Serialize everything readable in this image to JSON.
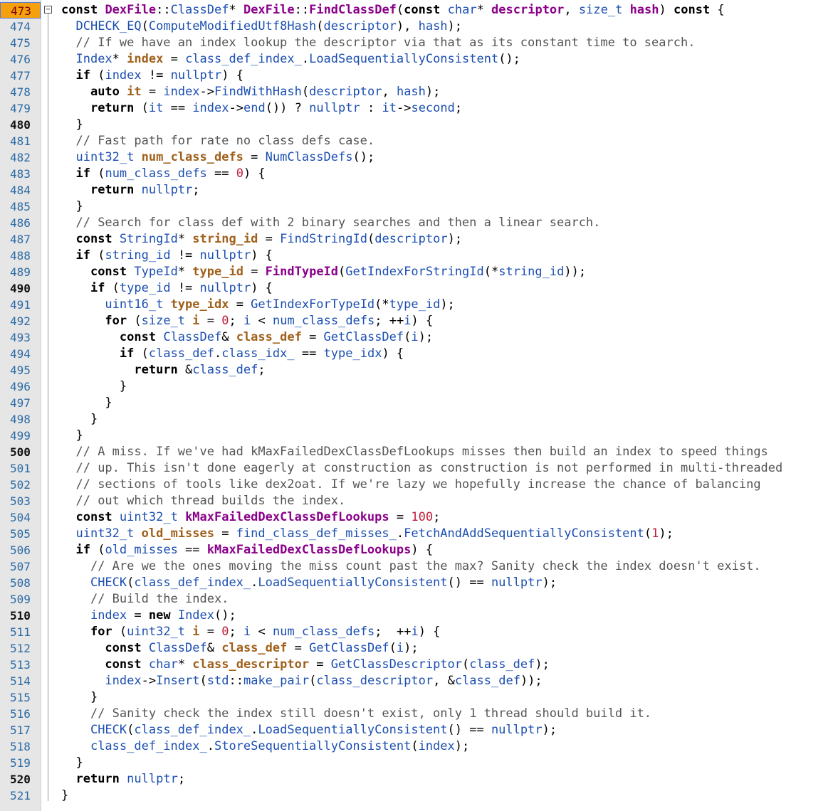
{
  "editor": {
    "current_line": "473",
    "lines": [
      {
        "n": "473",
        "t": "const DexFile::ClassDef* DexFile::FindClassDef(const char* descriptor, size_t hash) const {"
      },
      {
        "n": "474",
        "t": "  DCHECK_EQ(ComputeModifiedUtf8Hash(descriptor), hash);"
      },
      {
        "n": "475",
        "t": "  // If we have an index lookup the descriptor via that as its constant time to search."
      },
      {
        "n": "476",
        "t": "  Index* index = class_def_index_.LoadSequentiallyConsistent();"
      },
      {
        "n": "477",
        "t": "  if (index != nullptr) {"
      },
      {
        "n": "478",
        "t": "    auto it = index->FindWithHash(descriptor, hash);"
      },
      {
        "n": "479",
        "t": "    return (it == index->end()) ? nullptr : it->second;"
      },
      {
        "n": "480",
        "t": "  }"
      },
      {
        "n": "481",
        "t": "  // Fast path for rate no class defs case."
      },
      {
        "n": "482",
        "t": "  uint32_t num_class_defs = NumClassDefs();"
      },
      {
        "n": "483",
        "t": "  if (num_class_defs == 0) {"
      },
      {
        "n": "484",
        "t": "    return nullptr;"
      },
      {
        "n": "485",
        "t": "  }"
      },
      {
        "n": "486",
        "t": "  // Search for class def with 2 binary searches and then a linear search."
      },
      {
        "n": "487",
        "t": "  const StringId* string_id = FindStringId(descriptor);"
      },
      {
        "n": "488",
        "t": "  if (string_id != nullptr) {"
      },
      {
        "n": "489",
        "t": "    const TypeId* type_id = FindTypeId(GetIndexForStringId(*string_id));"
      },
      {
        "n": "490",
        "t": "    if (type_id != nullptr) {"
      },
      {
        "n": "491",
        "t": "      uint16_t type_idx = GetIndexForTypeId(*type_id);"
      },
      {
        "n": "492",
        "t": "      for (size_t i = 0; i < num_class_defs; ++i) {"
      },
      {
        "n": "493",
        "t": "        const ClassDef& class_def = GetClassDef(i);"
      },
      {
        "n": "494",
        "t": "        if (class_def.class_idx_ == type_idx) {"
      },
      {
        "n": "495",
        "t": "          return &class_def;"
      },
      {
        "n": "496",
        "t": "        }"
      },
      {
        "n": "497",
        "t": "      }"
      },
      {
        "n": "498",
        "t": "    }"
      },
      {
        "n": "499",
        "t": "  }"
      },
      {
        "n": "500",
        "t": "  // A miss. If we've had kMaxFailedDexClassDefLookups misses then build an index to speed things"
      },
      {
        "n": "501",
        "t": "  // up. This isn't done eagerly at construction as construction is not performed in multi-threaded"
      },
      {
        "n": "502",
        "t": "  // sections of tools like dex2oat. If we're lazy we hopefully increase the chance of balancing"
      },
      {
        "n": "503",
        "t": "  // out which thread builds the index."
      },
      {
        "n": "504",
        "t": "  const uint32_t kMaxFailedDexClassDefLookups = 100;"
      },
      {
        "n": "505",
        "t": "  uint32_t old_misses = find_class_def_misses_.FetchAndAddSequentiallyConsistent(1);"
      },
      {
        "n": "506",
        "t": "  if (old_misses == kMaxFailedDexClassDefLookups) {"
      },
      {
        "n": "507",
        "t": "    // Are we the ones moving the miss count past the max? Sanity check the index doesn't exist."
      },
      {
        "n": "508",
        "t": "    CHECK(class_def_index_.LoadSequentiallyConsistent() == nullptr);"
      },
      {
        "n": "509",
        "t": "    // Build the index."
      },
      {
        "n": "510",
        "t": "    index = new Index();"
      },
      {
        "n": "511",
        "t": "    for (uint32_t i = 0; i < num_class_defs;  ++i) {"
      },
      {
        "n": "512",
        "t": "      const ClassDef& class_def = GetClassDef(i);"
      },
      {
        "n": "513",
        "t": "      const char* class_descriptor = GetClassDescriptor(class_def);"
      },
      {
        "n": "514",
        "t": "      index->Insert(std::make_pair(class_descriptor, &class_def));"
      },
      {
        "n": "515",
        "t": "    }"
      },
      {
        "n": "516",
        "t": "    // Sanity check the index still doesn't exist, only 1 thread should build it."
      },
      {
        "n": "517",
        "t": "    CHECK(class_def_index_.LoadSequentiallyConsistent() == nullptr);"
      },
      {
        "n": "518",
        "t": "    class_def_index_.StoreSequentiallyConsistent(index);"
      },
      {
        "n": "519",
        "t": "  }"
      },
      {
        "n": "520",
        "t": "  return nullptr;"
      },
      {
        "n": "521",
        "t": "}"
      }
    ],
    "bold_line_numbers": [
      "480",
      "490",
      "500",
      "510",
      "520"
    ]
  }
}
